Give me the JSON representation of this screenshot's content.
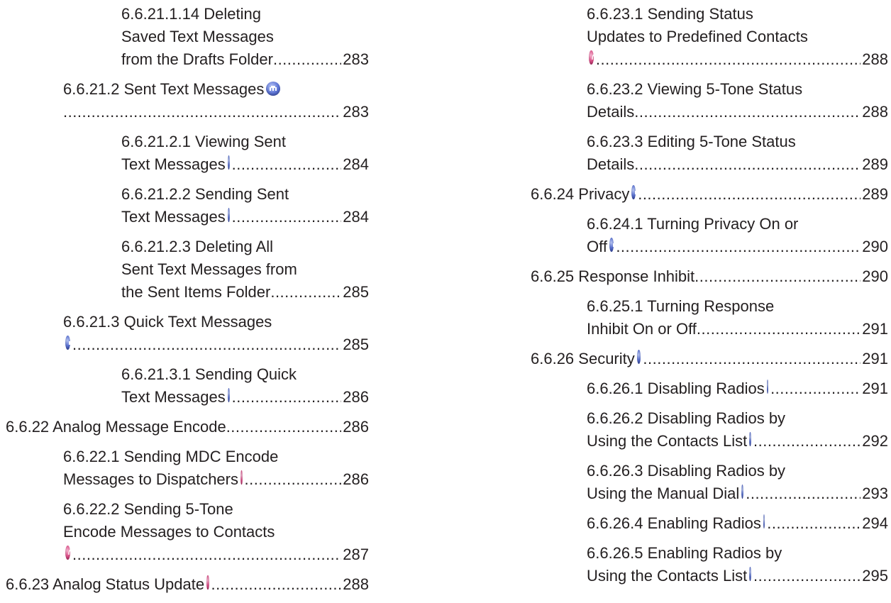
{
  "left": [
    {
      "lines": [
        "6.6.21.1.14 Deleting",
        "Saved Text Messages",
        "from the Drafts Folder"
      ],
      "icon": null,
      "page": "283",
      "level": 2
    },
    {
      "lines": [
        "6.6.21.2 Sent Text Messages"
      ],
      "icon": "digital",
      "page": "283",
      "level": 1,
      "icon_inline": true,
      "leader_own_line": true
    },
    {
      "lines": [
        "6.6.21.2.1 Viewing Sent",
        "Text Messages"
      ],
      "icon": "digital",
      "page": "284",
      "level": 2
    },
    {
      "lines": [
        "6.6.21.2.2 Sending Sent",
        "Text Messages"
      ],
      "icon": "digital",
      "page": "284",
      "level": 2
    },
    {
      "lines": [
        "6.6.21.2.3 Deleting All",
        "Sent Text Messages from",
        "the Sent Items Folder"
      ],
      "icon": null,
      "page": "285",
      "level": 2
    },
    {
      "lines": [
        "6.6.21.3 Quick Text Messages"
      ],
      "icon": "digital",
      "page": "285",
      "level": 1,
      "icon_on_leader": true
    },
    {
      "lines": [
        "6.6.21.3.1 Sending Quick",
        "Text Messages"
      ],
      "icon": "digital",
      "page": "286",
      "level": 2
    },
    {
      "lines": [
        "6.6.22 Analog Message Encode"
      ],
      "icon": null,
      "page": "286",
      "level": 0
    },
    {
      "lines": [
        "6.6.22.1 Sending MDC Encode",
        "Messages to Dispatchers"
      ],
      "icon": "analog",
      "page": "286",
      "level": 1
    },
    {
      "lines": [
        "6.6.22.2 Sending 5-Tone",
        "Encode Messages to Contacts"
      ],
      "icon": "analog",
      "page": "287",
      "level": 1,
      "icon_on_leader": true
    },
    {
      "lines": [
        "6.6.23 Analog Status Update"
      ],
      "icon": "analog",
      "page": "288",
      "level": 0
    }
  ],
  "right": [
    {
      "lines": [
        "6.6.23.1 Sending Status",
        "Updates to Predefined Contacts"
      ],
      "icon": "analog",
      "page": "288",
      "level": 1,
      "icon_on_leader": true
    },
    {
      "lines": [
        "6.6.23.2 Viewing 5-Tone Status",
        "Details"
      ],
      "icon": null,
      "page": "288",
      "level": 1
    },
    {
      "lines": [
        "6.6.23.3 Editing 5-Tone Status",
        "Details"
      ],
      "icon": null,
      "page": "289",
      "level": 1
    },
    {
      "lines": [
        "6.6.24 Privacy"
      ],
      "icon": "digital",
      "page": "289",
      "level": 0
    },
    {
      "lines": [
        "6.6.24.1 Turning Privacy On or",
        "Off"
      ],
      "icon": "digital",
      "page": "290",
      "level": 1
    },
    {
      "lines": [
        "6.6.25 Response Inhibit"
      ],
      "icon": null,
      "page": "290",
      "level": 0
    },
    {
      "lines": [
        "6.6.25.1 Turning Response",
        "Inhibit On or Off"
      ],
      "icon": null,
      "page": "291",
      "level": 1
    },
    {
      "lines": [
        "6.6.26 Security"
      ],
      "icon": "digital",
      "page": "291",
      "level": 0
    },
    {
      "lines": [
        "6.6.26.1 Disabling Radios"
      ],
      "icon": "digital",
      "page": "291",
      "level": 1
    },
    {
      "lines": [
        "6.6.26.2 Disabling Radios by",
        "Using the Contacts List"
      ],
      "icon": "digital",
      "page": "292",
      "level": 1
    },
    {
      "lines": [
        "6.6.26.3 Disabling Radios by",
        "Using the Manual Dial"
      ],
      "icon": "digital",
      "page": "293",
      "level": 1
    },
    {
      "lines": [
        "6.6.26.4 Enabling Radios"
      ],
      "icon": "digital",
      "page": "294",
      "level": 1
    },
    {
      "lines": [
        "6.6.26.5 Enabling Radios by",
        "Using the Contacts List"
      ],
      "icon": "digital",
      "page": "295",
      "level": 1
    }
  ],
  "icons": {
    "digital": {
      "name": "digital-mode-icon",
      "color": "#5b73d6"
    },
    "analog": {
      "name": "analog-mode-icon",
      "color": "#e4558f"
    }
  }
}
